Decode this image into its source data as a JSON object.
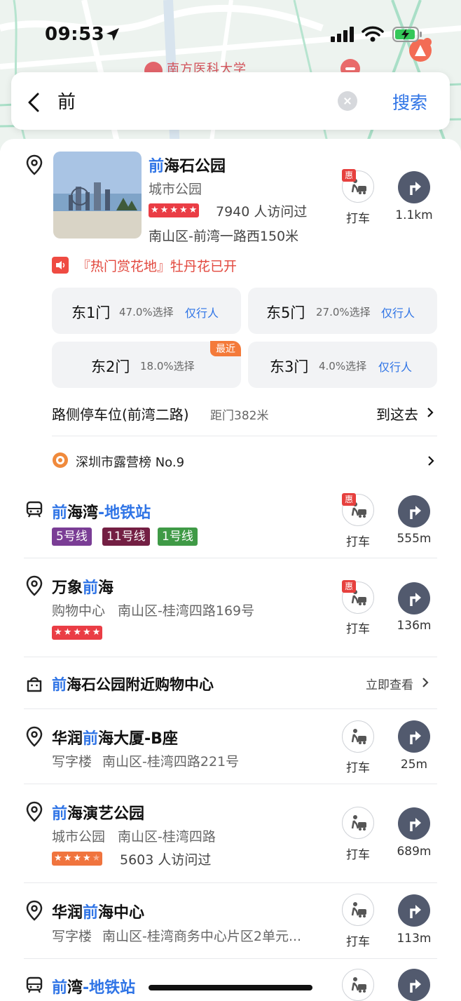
{
  "status_bar": {
    "time": "09:53"
  },
  "map": {
    "label_top": "南方医科大学"
  },
  "search": {
    "query": "前",
    "submit": "搜索"
  },
  "featured": {
    "name_hl": "前",
    "name_rest": "海石公园",
    "category": "城市公园",
    "rating_stars": 5,
    "visitors": "7940 人访问过",
    "address": "南山区-前湾一路西150米",
    "promo": "『热门赏花地』牡丹花已开",
    "taxi_label": "打车",
    "taxi_badge": "惠",
    "distance": "1.1km",
    "gates": [
      {
        "name": "东1门",
        "pct": "47.0%选择",
        "mode": "仅行人",
        "badge": ""
      },
      {
        "name": "东5门",
        "pct": "27.0%选择",
        "mode": "仅行人",
        "badge": ""
      },
      {
        "name": "东2门",
        "pct": "18.0%选择",
        "mode": "",
        "badge": "最近"
      },
      {
        "name": "东3门",
        "pct": "4.0%选择",
        "mode": "仅行人",
        "badge": ""
      }
    ],
    "parking": {
      "name": "路侧停车位(前湾二路)",
      "distance": "距门382米",
      "action": "到这去"
    },
    "ranking": "深圳市露营榜 No.9"
  },
  "results": [
    {
      "pre": "",
      "hl": "前",
      "post": "海湾",
      "suffix": "-地铁站",
      "icon": "metro-icon",
      "lines": [
        "5号线",
        "11号线",
        "1号线"
      ],
      "taxi_badge": "惠",
      "taxi": "打车",
      "distance": "555m"
    },
    {
      "pre": "万象",
      "hl": "前",
      "post": "海",
      "icon": "pin-icon",
      "category": "购物中心",
      "address": "南山区-桂湾四路169号",
      "rating_stars": 5,
      "taxi_badge": "惠",
      "taxi": "打车",
      "distance": "136m"
    },
    {
      "hl": "前",
      "post": "海石公园附近购物中心",
      "icon": "shopping-bag-icon",
      "action": "立即查看"
    },
    {
      "pre": "华润",
      "hl": "前",
      "post": "海大厦-B座",
      "icon": "pin-icon",
      "category": "写字楼",
      "address": "南山区-桂湾四路221号",
      "taxi": "打车",
      "distance": "25m"
    },
    {
      "pre": "",
      "hl": "前",
      "post": "海演艺公园",
      "icon": "pin-icon",
      "category": "城市公园",
      "address": "南山区-桂湾四路",
      "rating_stars": 4.5,
      "visitors": "5603 人访问过",
      "taxi": "打车",
      "distance": "689m"
    },
    {
      "pre": "华润",
      "hl": "前",
      "post": "海中心",
      "icon": "pin-icon",
      "category": "写字楼",
      "address": "南山区-桂湾商务中心片区2单元...",
      "taxi": "打车",
      "distance": "113m"
    },
    {
      "pre": "",
      "hl": "前",
      "post": "湾",
      "suffix": "-地铁站",
      "icon": "metro-icon"
    }
  ],
  "colors": {
    "accent": "#2f74e6",
    "rating": "#ea3d45",
    "rating_alt": "#f0743e",
    "line5": "#7a3d95",
    "line11": "#731f43",
    "line1": "#3f9a46"
  }
}
